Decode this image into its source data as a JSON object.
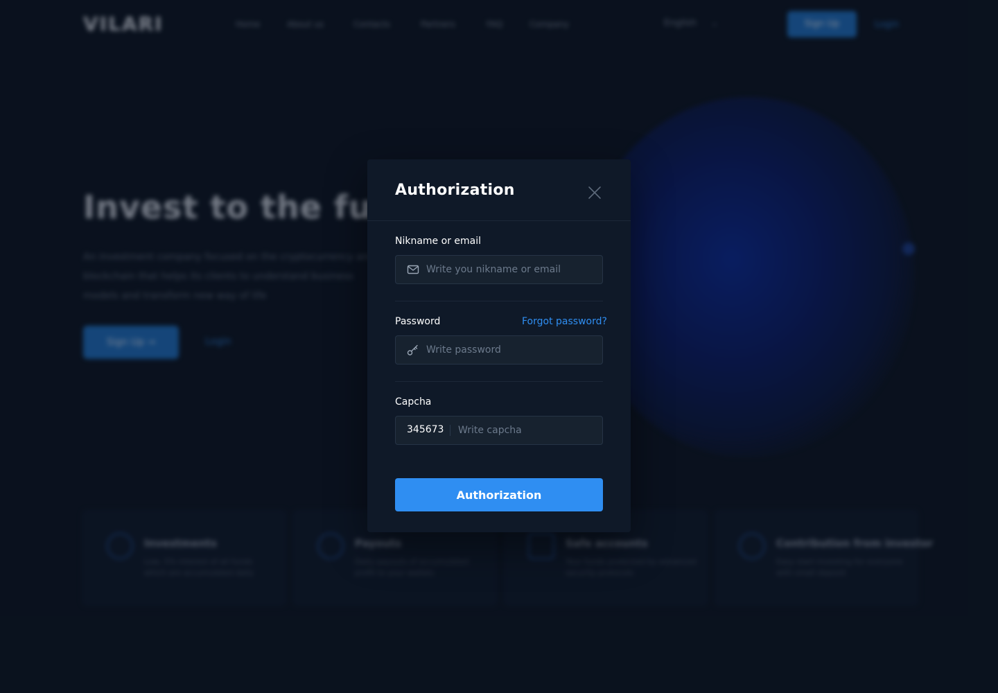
{
  "background": {
    "logo": "VILARI",
    "nav": {
      "links": [
        "Home",
        "About us",
        "Contacts",
        "Partners",
        "FAQ",
        "Company"
      ],
      "language": "English",
      "signup_label": "Sign Up",
      "login_label": "Login"
    },
    "hero": {
      "title": "Invest to the future",
      "text": "An investment company focused on the cryptocurrency and blockchain that helps its clients to understand business models and transform new way of life",
      "signup_label": "Sign Up →",
      "login_label": "Login"
    },
    "features": [
      {
        "title": "Investments",
        "text": "Low, 5% interest of all funds which are accumulated daily"
      },
      {
        "title": "Payouts",
        "text": "Daily payouts of accumulated profit to your wallets"
      },
      {
        "title": "Safe accounts",
        "text": "Your funds protected by advanced security protocols"
      },
      {
        "title": "Contribution from investor",
        "text": "Easy start investing for everyone with small deposit"
      }
    ]
  },
  "modal": {
    "title": "Authorization",
    "close_icon": "close-icon",
    "fields": {
      "login": {
        "label": "Nikname or email",
        "placeholder": "Write you nikname or email",
        "value": "",
        "icon": "mail-icon"
      },
      "password": {
        "label": "Password",
        "placeholder": "Write password",
        "value": "",
        "icon": "key-icon",
        "forgot_label": "Forgot password?"
      },
      "captcha": {
        "label": "Capcha",
        "code": "345673",
        "placeholder": "Write capcha",
        "value": ""
      }
    },
    "submit_label": "Authorization"
  },
  "colors": {
    "page_background": "#0b1523",
    "modal_background": "#0f1928",
    "input_background": "#17222f",
    "accent": "#2f8ef2"
  }
}
